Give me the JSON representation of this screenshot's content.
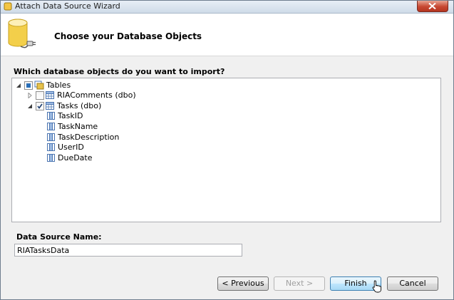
{
  "window": {
    "title": "Attach Data Source Wizard"
  },
  "header": {
    "title": "Choose your Database Objects"
  },
  "question": "Which database objects do you want to import?",
  "tree": {
    "root_label": "Tables",
    "items": [
      {
        "label": "RIAComments (dbo)",
        "checked": false,
        "expanded": false
      },
      {
        "label": "Tasks (dbo)",
        "checked": true,
        "expanded": true,
        "columns": [
          "TaskID",
          "TaskName",
          "TaskDescription",
          "UserID",
          "DueDate"
        ]
      }
    ]
  },
  "data_source": {
    "label": "Data Source Name:",
    "value": "RIATasksData"
  },
  "buttons": {
    "previous": "< Previous",
    "next": "Next >",
    "finish": "Finish",
    "cancel": "Cancel"
  },
  "colors": {
    "accent": "#3c7fb1",
    "close": "#c74832"
  }
}
